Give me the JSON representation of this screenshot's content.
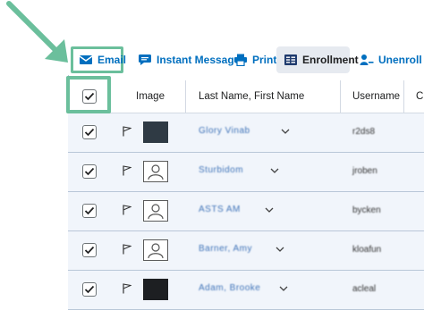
{
  "toolbar": {
    "email_label": "Email",
    "instant_message_label": "Instant Message",
    "print_label": "Print",
    "enrollment_label": "Enrollment",
    "unenroll_label": "Unenroll"
  },
  "table": {
    "columns": [
      "Image",
      "Last Name, First Name",
      "Username",
      "C"
    ],
    "rows": [
      {
        "selected": true,
        "image": "photo",
        "name": "Glory Vinab",
        "username": "r2ds8"
      },
      {
        "selected": true,
        "image": "placeholder",
        "name": "Sturbidom",
        "username": "jroben"
      },
      {
        "selected": true,
        "image": "placeholder",
        "name": "ASTS AM",
        "username": "bycken"
      },
      {
        "selected": true,
        "image": "placeholder",
        "name": "Barner, Amy",
        "username": "kloafun"
      },
      {
        "selected": true,
        "image": "photo",
        "name": "Adam, Brooke",
        "username": "acleal"
      }
    ]
  },
  "colors": {
    "accent": "#006fbf",
    "highlight": "#6bbf9c",
    "row_bg": "#f1f5fb"
  },
  "icons": [
    "envelope-icon",
    "chat-icon",
    "printer-icon",
    "enrollment-icon",
    "unenroll-icon",
    "checkbox-checked-icon",
    "flag-icon",
    "chevron-down-icon",
    "avatar-placeholder-icon"
  ]
}
